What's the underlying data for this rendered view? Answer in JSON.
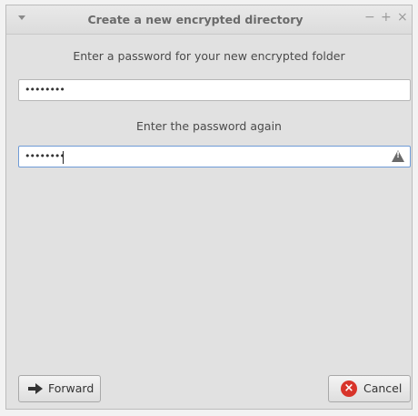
{
  "window": {
    "title": "Create a new encrypted directory",
    "controls": {
      "minimize": "−",
      "maximize": "+",
      "close": "×"
    }
  },
  "form": {
    "password_prompt": "Enter a password for your new encrypted folder",
    "password_value": "••••••••",
    "confirm_prompt": "Enter the password again",
    "confirm_value": "••••••••"
  },
  "buttons": {
    "forward_label": "Forward",
    "cancel_label": "Cancel"
  },
  "icons": {
    "menu": "chevron-down-icon",
    "warning": "warning-icon",
    "forward": "arrow-right-icon",
    "cancel": "cancel-icon"
  }
}
